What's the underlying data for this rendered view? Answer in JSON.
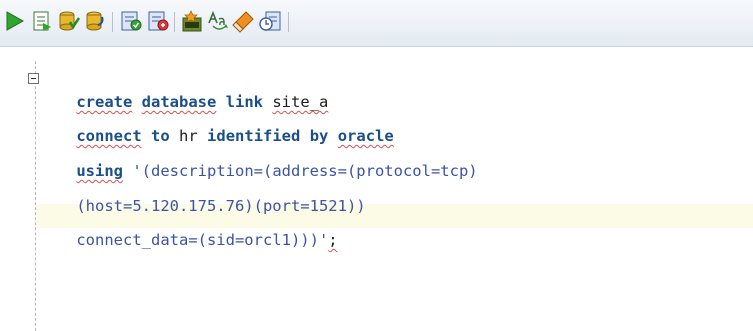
{
  "toolbar": {
    "buttons": [
      {
        "icon": "run-statement-icon"
      },
      {
        "icon": "run-script-icon"
      },
      {
        "icon": "commit-icon"
      },
      {
        "icon": "rollback-icon"
      },
      {
        "icon": "explain-plan-icon"
      },
      {
        "icon": "autotrace-icon"
      },
      {
        "icon": "sql-tuning-icon"
      },
      {
        "icon": "to-upper-lower-icon"
      },
      {
        "icon": "clear-icon"
      },
      {
        "icon": "sql-history-icon"
      }
    ]
  },
  "editor": {
    "lines": [
      [
        "create",
        " ",
        "database",
        " ",
        "link",
        " ",
        "site_a"
      ],
      [
        "connect",
        " ",
        "to",
        " ",
        "hr",
        " ",
        "identified",
        " ",
        "by",
        " ",
        "oracle"
      ],
      [
        "using",
        " ",
        "'(description=(address=(protocol=tcp)"
      ],
      [
        "(host=5.120.175.76)(port=1521))"
      ],
      [
        "connect_data=(sid=orcl1)))'",
        ";"
      ]
    ]
  },
  "colors": {
    "keyword": "#1a4f8a",
    "string": "#3c53a6",
    "current_line": "#fbfbe6"
  }
}
